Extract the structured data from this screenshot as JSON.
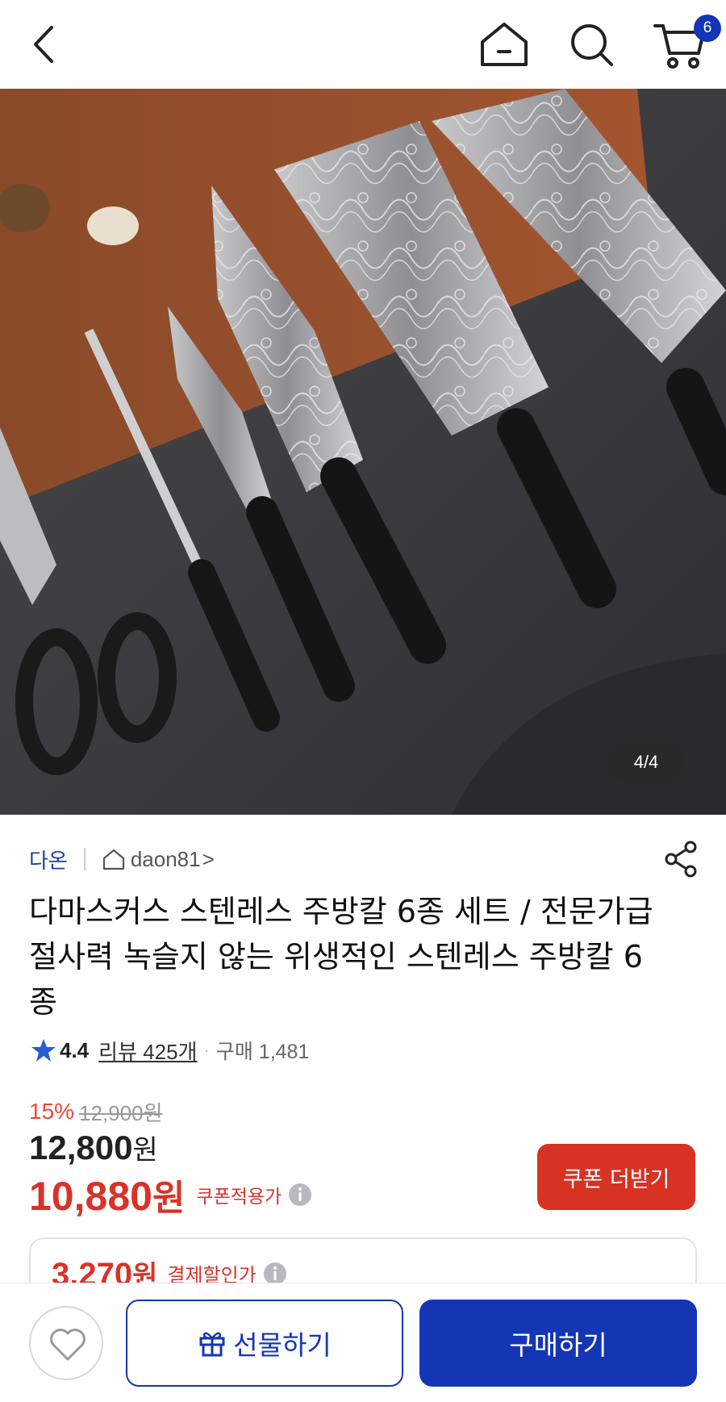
{
  "header": {
    "back_icon": "chevron-left-icon",
    "home_icon": "home-icon",
    "search_icon": "search-icon",
    "cart_icon": "cart-icon",
    "cart_badge": "6",
    "accent_color": "#1436b4"
  },
  "gallery": {
    "counter": "4/4"
  },
  "seller": {
    "brand": "다온",
    "store_name": "daon81",
    "chevron": ">"
  },
  "product": {
    "title": "다마스커스 스텐레스 주방칼 6종 세트 / 전문가급 절사력 녹슬지 않는 위생적인 스텐레스 주방칼 6종",
    "rating": "4.4",
    "review_link": "리뷰 425개",
    "separator": "·",
    "purchase_count": "구매 1,481"
  },
  "price": {
    "discount_rate": "15%",
    "original_price": "12,900원",
    "sale_price_number": "12,800",
    "sale_price_unit": "원",
    "coupon_price_number": "10,880",
    "coupon_price_unit": "원",
    "coupon_note": "쿠폰적용가",
    "coupon_button": "쿠폰 더받기",
    "discount_color": "#d8332a"
  },
  "payment_discount": {
    "amount_number": "3,270",
    "amount_unit": "원",
    "label": "결제할인가"
  },
  "bottom_bar": {
    "wish_icon": "heart-icon",
    "gift_button": "선물하기",
    "buy_button": "구매하기"
  }
}
